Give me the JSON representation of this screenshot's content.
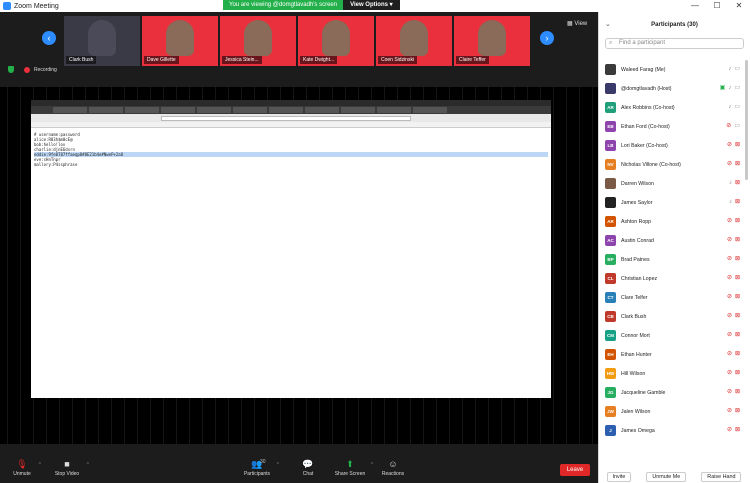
{
  "window": {
    "title": "Zoom Meeting",
    "controls": [
      "—",
      "☐",
      "✕"
    ]
  },
  "banner": {
    "message": "You are viewing @domgtlavadh's screen",
    "options_label": "View Options"
  },
  "thumbnails": [
    {
      "name": "Clark Bush"
    },
    {
      "name": "Dave Gillette"
    },
    {
      "name": "Jessica Stein..."
    },
    {
      "name": "Kate Dwight..."
    },
    {
      "name": "Coen Sidzinski"
    },
    {
      "name": "Claire Teffer"
    }
  ],
  "view_label": "View",
  "recording_label": "Recording",
  "shared_screen": {
    "lines": [
      "# username:password",
      "alice:R83h$m0cE@",
      "bob:hello!lov",
      "charlie:djnE6dvrn",
      "eddie:9fe8787ffaeqp8#8E21b4e#NweP+2aO",
      "eve:sHnTnpr",
      "mallory:P4ssphrase"
    ],
    "highlighted_line": 4
  },
  "toolbar": {
    "unmute": "Unmute",
    "stop_video": "Stop Video",
    "participants": "Participants",
    "participants_count": "30",
    "chat": "Chat",
    "share_screen": "Share Screen",
    "reactions": "Reactions",
    "leave": "Leave"
  },
  "panel": {
    "title": "Participants (30)",
    "search_placeholder": "Find a participant",
    "participants": [
      {
        "name": "Waleed Farag (Me)",
        "initials": "",
        "color": "#3a3a3a",
        "photo": true,
        "mic_off": false,
        "cam_off": false
      },
      {
        "name": "@domgtlavadh (Host)",
        "initials": "",
        "color": "#3a3a6a",
        "photo": true,
        "mic_off": false,
        "cam_off": false,
        "sharing": true
      },
      {
        "name": "Alex Robbins (Co-host)",
        "initials": "AR",
        "color": "#1fa07a",
        "mic_off": false,
        "cam_off": false
      },
      {
        "name": "Ethan Ford (Co-host)",
        "initials": "EB",
        "color": "#8e44ad",
        "mic_off": true,
        "cam_off": false
      },
      {
        "name": "Lori Baker (Co-host)",
        "initials": "LB",
        "color": "#8e44ad",
        "mic_off": true,
        "cam_off": true
      },
      {
        "name": "Nicholas Villone (Co-host)",
        "initials": "NV",
        "color": "#e67e22",
        "mic_off": true,
        "cam_off": true
      },
      {
        "name": "Darren Wilson",
        "initials": "",
        "color": "#7a5a46",
        "photo": true,
        "mic_off": false,
        "cam_off": true
      },
      {
        "name": "James Saylor",
        "initials": "",
        "color": "#222222",
        "photo": true,
        "mic_off": false,
        "cam_off": true
      },
      {
        "name": "Ashton Ropp",
        "initials": "AR",
        "color": "#d35400",
        "mic_off": true,
        "cam_off": true
      },
      {
        "name": "Austin Conrad",
        "initials": "AC",
        "color": "#8e44ad",
        "mic_off": true,
        "cam_off": true
      },
      {
        "name": "Brad Patnes",
        "initials": "BP",
        "color": "#27ae60",
        "mic_off": true,
        "cam_off": true
      },
      {
        "name": "Christian Lopez",
        "initials": "CL",
        "color": "#c0392b",
        "mic_off": true,
        "cam_off": true
      },
      {
        "name": "Clare Telfer",
        "initials": "CT",
        "color": "#2980b9",
        "mic_off": true,
        "cam_off": true
      },
      {
        "name": "Clark Bush",
        "initials": "CB",
        "color": "#c0392b",
        "mic_off": true,
        "cam_off": true
      },
      {
        "name": "Connor Mort",
        "initials": "CM",
        "color": "#16a085",
        "mic_off": true,
        "cam_off": true
      },
      {
        "name": "Ethan Hunter",
        "initials": "EH",
        "color": "#d35400",
        "mic_off": true,
        "cam_off": true
      },
      {
        "name": "Hill Wilson",
        "initials": "HW",
        "color": "#f39c12",
        "mic_off": true,
        "cam_off": true
      },
      {
        "name": "Jacqueline Gamble",
        "initials": "JG",
        "color": "#27ae60",
        "mic_off": true,
        "cam_off": true
      },
      {
        "name": "Jalen Wilson",
        "initials": "JW",
        "color": "#e67e22",
        "mic_off": true,
        "cam_off": true
      },
      {
        "name": "James Omega",
        "initials": "J",
        "color": "#2c5fb0",
        "mic_off": true,
        "cam_off": true
      }
    ],
    "footer": {
      "invite": "Invite",
      "mute_me": "Unmute Me",
      "raise_hand": "Raise Hand"
    }
  }
}
